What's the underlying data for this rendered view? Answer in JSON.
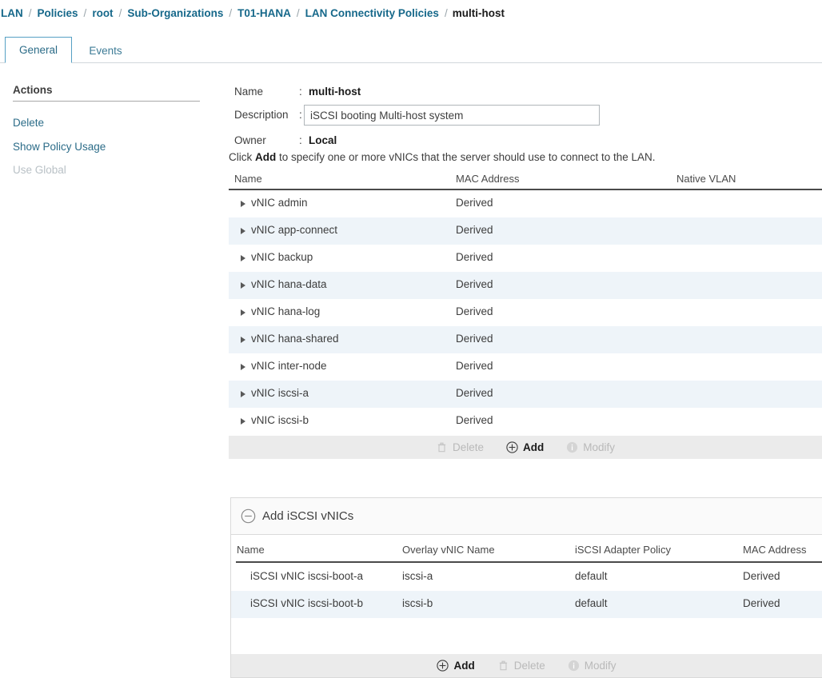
{
  "breadcrumb": {
    "separator": "/",
    "items": [
      {
        "label": "LAN",
        "current": false
      },
      {
        "label": "Policies",
        "current": false
      },
      {
        "label": "root",
        "current": false
      },
      {
        "label": "Sub-Organizations",
        "current": false
      },
      {
        "label": "T01-HANA",
        "current": false
      },
      {
        "label": "LAN Connectivity Policies",
        "current": false
      },
      {
        "label": "multi-host",
        "current": true
      }
    ]
  },
  "tabs": [
    {
      "label": "General",
      "active": true
    },
    {
      "label": "Events",
      "active": false
    }
  ],
  "actions": {
    "title": "Actions",
    "items": [
      {
        "label": "Delete",
        "enabled": true
      },
      {
        "label": "Show Policy Usage",
        "enabled": true
      },
      {
        "label": "Use Global",
        "enabled": false
      }
    ]
  },
  "form": {
    "name_label": "Name",
    "name_value": "multi-host",
    "description_label": "Description",
    "description_value": "iSCSI booting Multi-host system",
    "description_placeholder": "",
    "owner_label": "Owner",
    "owner_value": "Local",
    "colon": ":",
    "hint_prefix": "Click ",
    "hint_bold": "Add",
    "hint_suffix": " to specify one or more vNICs that the server should use to connect to the LAN."
  },
  "vnic_table": {
    "columns": [
      "Name",
      "MAC Address",
      "Native VLAN"
    ],
    "rows": [
      {
        "name": "vNIC admin",
        "mac": "Derived",
        "vlan": ""
      },
      {
        "name": "vNIC app-connect",
        "mac": "Derived",
        "vlan": ""
      },
      {
        "name": "vNIC backup",
        "mac": "Derived",
        "vlan": ""
      },
      {
        "name": "vNIC hana-data",
        "mac": "Derived",
        "vlan": ""
      },
      {
        "name": "vNIC hana-log",
        "mac": "Derived",
        "vlan": ""
      },
      {
        "name": "vNIC hana-shared",
        "mac": "Derived",
        "vlan": ""
      },
      {
        "name": "vNIC inter-node",
        "mac": "Derived",
        "vlan": ""
      },
      {
        "name": "vNIC iscsi-a",
        "mac": "Derived",
        "vlan": ""
      },
      {
        "name": "vNIC iscsi-b",
        "mac": "Derived",
        "vlan": ""
      }
    ],
    "toolbar": [
      {
        "label": "Delete",
        "icon": "trash-icon",
        "enabled": false
      },
      {
        "label": "Add",
        "icon": "plus-circle-icon",
        "enabled": true
      },
      {
        "label": "Modify",
        "icon": "info-circle-icon",
        "enabled": false
      }
    ]
  },
  "iscsi_section": {
    "title": "Add iSCSI vNICs",
    "collapse_icon": "minus-circle-icon",
    "columns": [
      "Name",
      "Overlay vNIC Name",
      "iSCSI Adapter Policy",
      "MAC Address"
    ],
    "rows": [
      {
        "name": "iSCSI vNIC iscsi-boot-a",
        "overlay": "iscsi-a",
        "policy": "default",
        "mac": "Derived"
      },
      {
        "name": "iSCSI vNIC iscsi-boot-b",
        "overlay": "iscsi-b",
        "policy": "default",
        "mac": "Derived"
      }
    ],
    "toolbar": [
      {
        "label": "Add",
        "icon": "plus-circle-icon",
        "enabled": true
      },
      {
        "label": "Delete",
        "icon": "trash-icon",
        "enabled": false
      },
      {
        "label": "Modify",
        "icon": "info-circle-icon",
        "enabled": false
      }
    ]
  },
  "colors": {
    "link": "#16688a",
    "tab_active_border": "#56a0c4",
    "row_alt": "#eef4f9",
    "toolbar_bg": "#ebebeb",
    "rule_dark": "#4a4a4a"
  }
}
